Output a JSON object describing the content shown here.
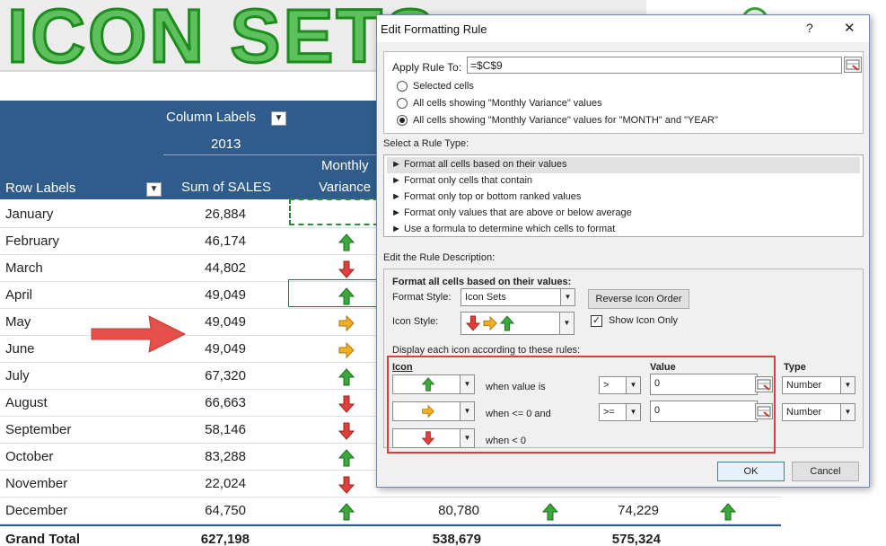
{
  "banner": {
    "title": "ICON SETS"
  },
  "pivot": {
    "column_labels": "Column Labels",
    "year": "2013",
    "row_labels": "Row Labels",
    "sum_header": "Sum of SALES",
    "monthly": "Monthly",
    "variance": "Variance",
    "rows": [
      {
        "month": "January",
        "sales": "26,884",
        "icon": "",
        "c4": "",
        "icon2": "",
        "c6": "",
        "icon3": ""
      },
      {
        "month": "February",
        "sales": "46,174",
        "icon": "up-arrow-icon",
        "c4": "",
        "icon2": "",
        "c6": "",
        "icon3": ""
      },
      {
        "month": "March",
        "sales": "44,802",
        "icon": "down-arrow-icon",
        "c4": "",
        "icon2": "",
        "c6": "",
        "icon3": ""
      },
      {
        "month": "April",
        "sales": "49,049",
        "icon": "up-arrow-icon",
        "c4": "",
        "icon2": "",
        "c6": "",
        "icon3": ""
      },
      {
        "month": "May",
        "sales": "49,049",
        "icon": "right-arrow-icon",
        "c4": "",
        "icon2": "",
        "c6": "",
        "icon3": ""
      },
      {
        "month": "June",
        "sales": "49,049",
        "icon": "right-arrow-icon",
        "c4": "",
        "icon2": "",
        "c6": "",
        "icon3": ""
      },
      {
        "month": "July",
        "sales": "67,320",
        "icon": "up-arrow-icon",
        "c4": "",
        "icon2": "",
        "c6": "",
        "icon3": ""
      },
      {
        "month": "August",
        "sales": "66,663",
        "icon": "down-arrow-icon",
        "c4": "",
        "icon2": "",
        "c6": "",
        "icon3": ""
      },
      {
        "month": "September",
        "sales": "58,146",
        "icon": "down-arrow-icon",
        "c4": "",
        "icon2": "",
        "c6": "",
        "icon3": ""
      },
      {
        "month": "October",
        "sales": "83,288",
        "icon": "up-arrow-icon",
        "c4": "",
        "icon2": "",
        "c6": "",
        "icon3": ""
      },
      {
        "month": "November",
        "sales": "22,024",
        "icon": "down-arrow-icon",
        "c4": "",
        "icon2": "",
        "c6": "",
        "icon3": ""
      },
      {
        "month": "December",
        "sales": "64,750",
        "icon": "up-arrow-icon",
        "c4": "80,780",
        "icon2": "up-arrow-icon",
        "c6": "74,229",
        "icon3": "up-arrow-icon"
      }
    ],
    "grand_total": {
      "label": "Grand Total",
      "sales": "627,198",
      "c4": "538,679",
      "c6": "575,324"
    }
  },
  "dialog": {
    "title": "Edit Formatting Rule",
    "help": "?",
    "close": "✕",
    "apply_label": "Apply Rule To:",
    "apply_value": "=$C$9",
    "radios": [
      "Selected cells",
      "All cells showing \"Monthly Variance\" values",
      "All cells showing \"Monthly Variance\" values for \"MONTH\" and \"YEAR\""
    ],
    "select_rule_type": "Select a Rule Type:",
    "rule_types": [
      "► Format all cells based on their values",
      "► Format only cells that contain",
      "► Format only top or bottom ranked values",
      "► Format only values that are above or below average",
      "► Use a formula to determine which cells to format"
    ],
    "edit_desc": "Edit the Rule Description:",
    "format_all": "Format all cells based on their values:",
    "format_style_label": "Format Style:",
    "format_style_value": "Icon Sets",
    "reverse_btn": "Reverse Icon Order",
    "icon_style_label": "Icon Style:",
    "show_icon_only": "Show Icon Only",
    "display_rules": "Display each icon according to these rules:",
    "col_icon": "Icon",
    "col_value": "Value",
    "col_type": "Type",
    "rules": [
      {
        "icon": "up-arrow-icon",
        "when": "when value is",
        "op": ">",
        "value": "0",
        "type": "Number"
      },
      {
        "icon": "right-arrow-icon",
        "when": "when <= 0 and",
        "op": ">=",
        "value": "0",
        "type": "Number"
      },
      {
        "icon": "down-arrow-icon",
        "when": "when < 0",
        "op": "",
        "value": "",
        "type": ""
      }
    ],
    "ok": "OK",
    "cancel": "Cancel"
  },
  "colors": {
    "up": "#3aa83a",
    "right": "#f2b01e",
    "down": "#e0403a",
    "header": "#2f5c8a",
    "red_outline": "#d9403a"
  }
}
